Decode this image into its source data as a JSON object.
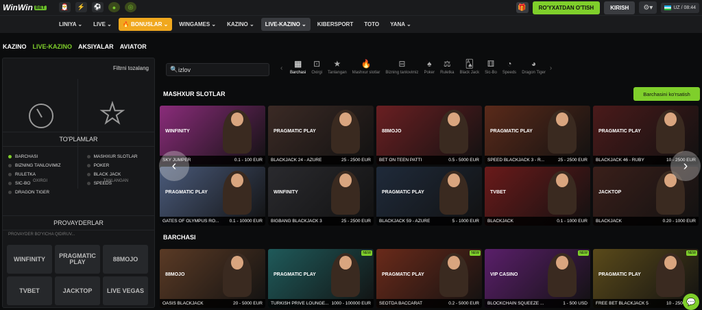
{
  "brand": {
    "name": "WinWin",
    "tag": "BET"
  },
  "header": {
    "register": "RO'YXATDAN O'TISH",
    "login": "KIRISH",
    "lang": "UZ / 08:44"
  },
  "nav": [
    {
      "label": "LINIYA ⌄"
    },
    {
      "label": "LIVE ⌄"
    },
    {
      "label": "🔥 BONUSLAR ⌄"
    },
    {
      "label": "WINGAMES ⌄"
    },
    {
      "label": "KAZINO ⌄"
    },
    {
      "label": "LIVE-KAZINO ⌄"
    },
    {
      "label": "KIBERSPORT"
    },
    {
      "label": "TOTO"
    },
    {
      "label": "YANA ⌄"
    }
  ],
  "subnav": [
    "KAZINO",
    "LIVE-KAZINO",
    "AKSIYALAR",
    "AVIATOR"
  ],
  "sidebar": {
    "sort": "Filtrni tozalang",
    "oxirgi": "OXIRGI",
    "tanlangan": "TANLANGAN",
    "collections_title": "TO'PLAMLAR",
    "col1": [
      "BARCHASI",
      "BIZNING TANLOVIMIZ",
      "RULETKA",
      "SIC-BO",
      "DRAGON TIGER"
    ],
    "col2": [
      "MASHXUR SLOTLAR",
      "POKER",
      "BLACK JACK",
      "SPEEDS"
    ],
    "providers_title": "PROVAYDERLAR",
    "provider_search": "PROVAYDER BO'YICHA QIDIRUV...",
    "providers": [
      "WINFINITY",
      "PRAGMATIC PLAY",
      "88MOJO",
      "TVBET",
      "JACKTOP",
      "LIVE VEGAS"
    ]
  },
  "search": {
    "value": "izlov"
  },
  "categories": [
    {
      "icon": "▦",
      "label": "Barchasi"
    },
    {
      "icon": "⊡",
      "label": "Oxirgi"
    },
    {
      "icon": "★",
      "label": "Tanlangan"
    },
    {
      "icon": "🔥",
      "label": "Mashxur slotlar"
    },
    {
      "icon": "⊟",
      "label": "Bizning tanlovimiz"
    },
    {
      "icon": "♠",
      "label": "Poker"
    },
    {
      "icon": "⚖",
      "label": "Ruletka"
    },
    {
      "icon": "🂡",
      "label": "Black Jack"
    },
    {
      "icon": "⚅",
      "label": "Sic-Bo"
    },
    {
      "icon": "◔",
      "label": "Speeds"
    },
    {
      "icon": "◕",
      "label": "Dragon Tiger"
    }
  ],
  "popular": {
    "title": "MASHXUR SLOTLAR",
    "all_button": "Barchasini ko'rsatish",
    "games": [
      {
        "name": "SKY JUMPER",
        "range": "0.1 - 100 EUR",
        "provider": "WINFINITY",
        "bg": "#8a2c7a"
      },
      {
        "name": "BLACKJACK 24 - AZURE",
        "range": "25 - 2500 EUR",
        "provider": "PRAGMATIC PLAY",
        "bg": "#3b2a25"
      },
      {
        "name": "BET ON TEEN PATTI",
        "range": "0.5 - 5000 EUR",
        "provider": "88MOJO",
        "bg": "#6a1f22"
      },
      {
        "name": "SPEED BLACKJACK 3 - R...",
        "range": "25 - 2500 EUR",
        "provider": "PRAGMATIC PLAY",
        "bg": "#5a2a1a"
      },
      {
        "name": "BLACKJACK 46 - RUBY",
        "range": "10 - 2500 EUR",
        "provider": "PRAGMATIC PLAY",
        "bg": "#4a1a1a"
      },
      {
        "name": "GATES OF OLYMPUS RO...",
        "range": "0.1 - 10000 EUR",
        "provider": "PRAGMATIC PLAY",
        "bg": "#4a5a7a"
      },
      {
        "name": "BIGBANG BLACKJACK 3",
        "range": "25 - 2500 EUR",
        "provider": "WINFINITY",
        "bg": "#2a2a2e"
      },
      {
        "name": "BLACKJACK 59 - AZURE",
        "range": "5 - 1000 EUR",
        "provider": "PRAGMATIC PLAY",
        "bg": "#1f2a3a"
      },
      {
        "name": "BLACKJACK",
        "range": "0.1 - 1000 EUR",
        "provider": "TVBET",
        "bg": "#6a1a1a"
      },
      {
        "name": "BLACKJACK",
        "range": "0.20 - 1000 EUR",
        "provider": "JACKTOP",
        "bg": "#3a1f1a"
      }
    ]
  },
  "all_section": {
    "title": "BARCHASI",
    "games": [
      {
        "name": "OASIS BLACKJACK",
        "range": "20 - 5000 EUR",
        "provider": "88MOJO",
        "bg": "#5a3a25",
        "new": ""
      },
      {
        "name": "TURKISH PRIVE LOUNGE...",
        "range": "1000 - 100000 EUR",
        "provider": "PRAGMATIC PLAY",
        "bg": "#1f5a5a",
        "new": "NEW"
      },
      {
        "name": "SEOTDA BACCARAT",
        "range": "0.2 - 5000 EUR",
        "provider": "PRAGMATIC PLAY",
        "bg": "#6a2a1a",
        "new": "NEW"
      },
      {
        "name": "BLOCKCHAIN SQUEEZE ...",
        "range": "1 - 500 USD",
        "provider": "VIP CASINO",
        "bg": "#5a1f6a",
        "new": "NEW"
      },
      {
        "name": "FREE BET BLACKJACK 5",
        "range": "10 - 2500 EUR",
        "provider": "PRAGMATIC PLAY",
        "bg": "#5a4a1a",
        "new": "NEW"
      }
    ]
  }
}
